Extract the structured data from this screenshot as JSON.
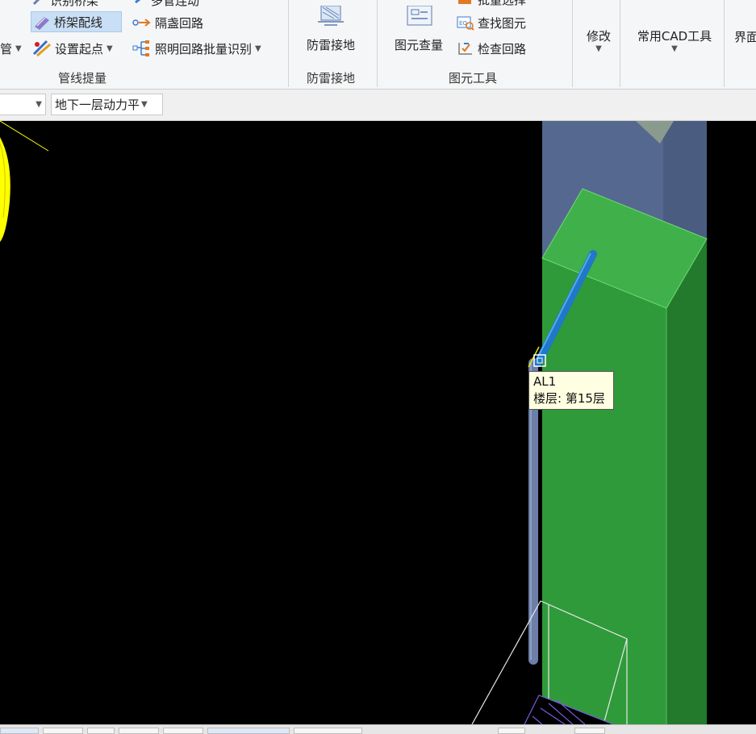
{
  "ribbon": {
    "row1": {
      "item_a": "识别桥架",
      "item_b": "多管连动"
    },
    "tray_wiring": "桥架配线",
    "isolated_loop": "隔盏回路",
    "pipe_left": "管",
    "set_start": "设置起点",
    "lighting_batch": "照明回路批量识别",
    "group_pipeline": "管线提量",
    "lightning_ground": "防雷接地",
    "group_lightning": "防雷接地",
    "element_quantity": "图元查量",
    "batch_select": "批量选择",
    "find_element": "查找图元",
    "check_loop": "检查回路",
    "group_element_tools": "图元工具",
    "modify": "修改",
    "cad_tools": "常用CAD工具",
    "interface_partial": "界面"
  },
  "toolbar2": {
    "floor_select": "地下一层动力平"
  },
  "tooltip": {
    "line1": "AL1",
    "line2": "楼层: 第15层"
  },
  "colors": {
    "viewport_bg": "#000000",
    "green_box": "#2f9a3a",
    "pipe_blue": "#1f78c8",
    "yellow": "#ffff00",
    "accent_select": "#c9dff5"
  }
}
